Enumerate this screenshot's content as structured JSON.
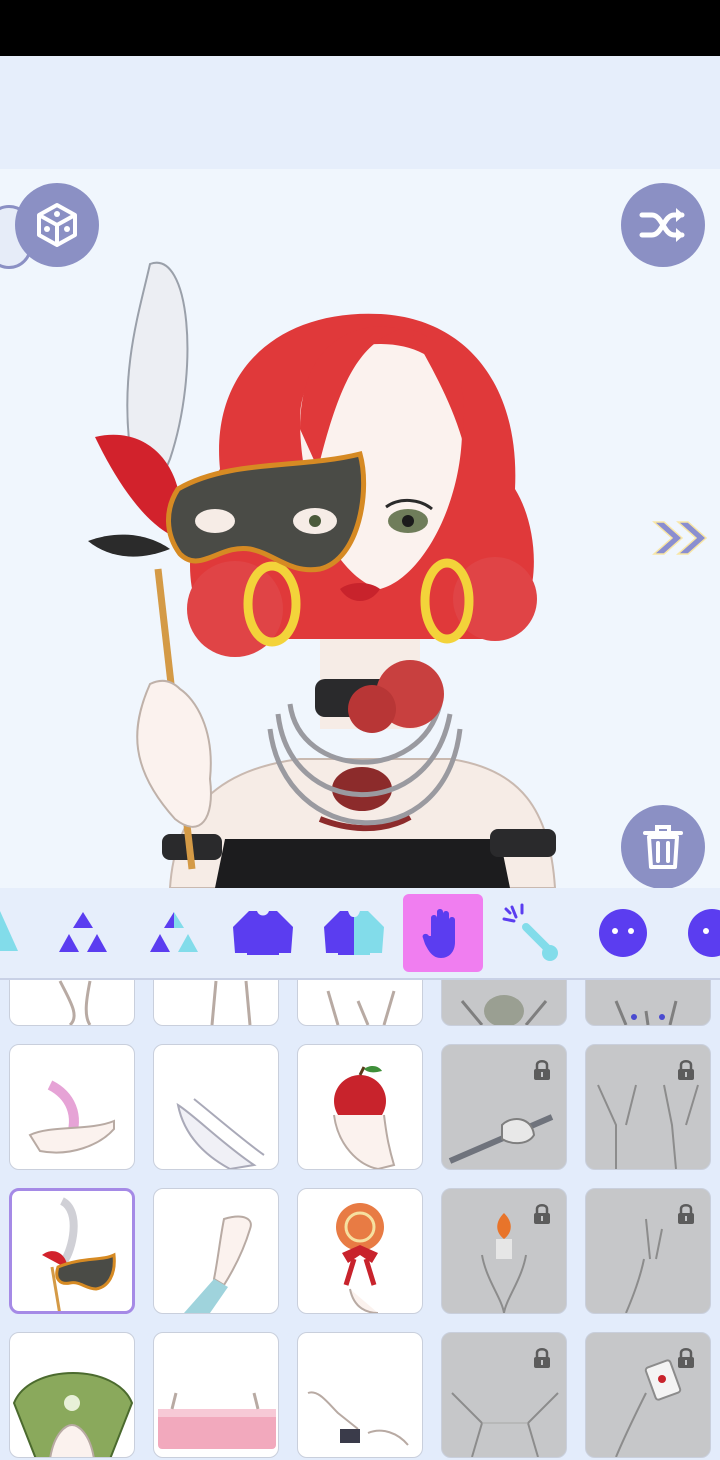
{
  "toolbar": {
    "left_button_icon": "dice-icon",
    "right_button_icon": "shuffle-icon",
    "delete_button_icon": "trash-icon",
    "next_icon": "double-chevron-right-icon"
  },
  "tabs": [
    {
      "icon": "partial-hair-icon"
    },
    {
      "icon": "triangles-icon"
    },
    {
      "icon": "triangles-split-icon"
    },
    {
      "icon": "top-shirt-icon"
    },
    {
      "icon": "top-shirt-split-icon"
    },
    {
      "icon": "hand-icon",
      "active": true
    },
    {
      "icon": "magic-wand-icon"
    },
    {
      "icon": "face-icon"
    },
    {
      "icon": "face-split-icon"
    }
  ],
  "items": [
    {
      "art": "hand-down",
      "locked": false
    },
    {
      "art": "hand-down",
      "locked": false
    },
    {
      "art": "hands-pair",
      "locked": false
    },
    {
      "art": "hands-skeleton",
      "locked": true
    },
    {
      "art": "hands-claws",
      "locked": true
    },
    {
      "art": "feather-hand",
      "locked": false
    },
    {
      "art": "praying-hands",
      "locked": false
    },
    {
      "art": "apple-hand",
      "locked": false
    },
    {
      "art": "dagger-hand",
      "locked": true
    },
    {
      "art": "open-hands",
      "locked": true
    },
    {
      "art": "mask-stick",
      "locked": false,
      "selected": true
    },
    {
      "art": "raised-hand-blue",
      "locked": false
    },
    {
      "art": "lollipop",
      "locked": false
    },
    {
      "art": "flame-hands",
      "locked": true
    },
    {
      "art": "peace-hand",
      "locked": true
    },
    {
      "art": "money-fan",
      "locked": false
    },
    {
      "art": "pink-banner",
      "locked": false
    },
    {
      "art": "cuffed-hands",
      "locked": false
    },
    {
      "art": "string-hands",
      "locked": true
    },
    {
      "art": "card-hand",
      "locked": true
    }
  ],
  "colors": {
    "accent": "#5b3df0",
    "button": "#8b90c4",
    "active_tab": "#f07ef0",
    "hair": "#e0393a"
  }
}
